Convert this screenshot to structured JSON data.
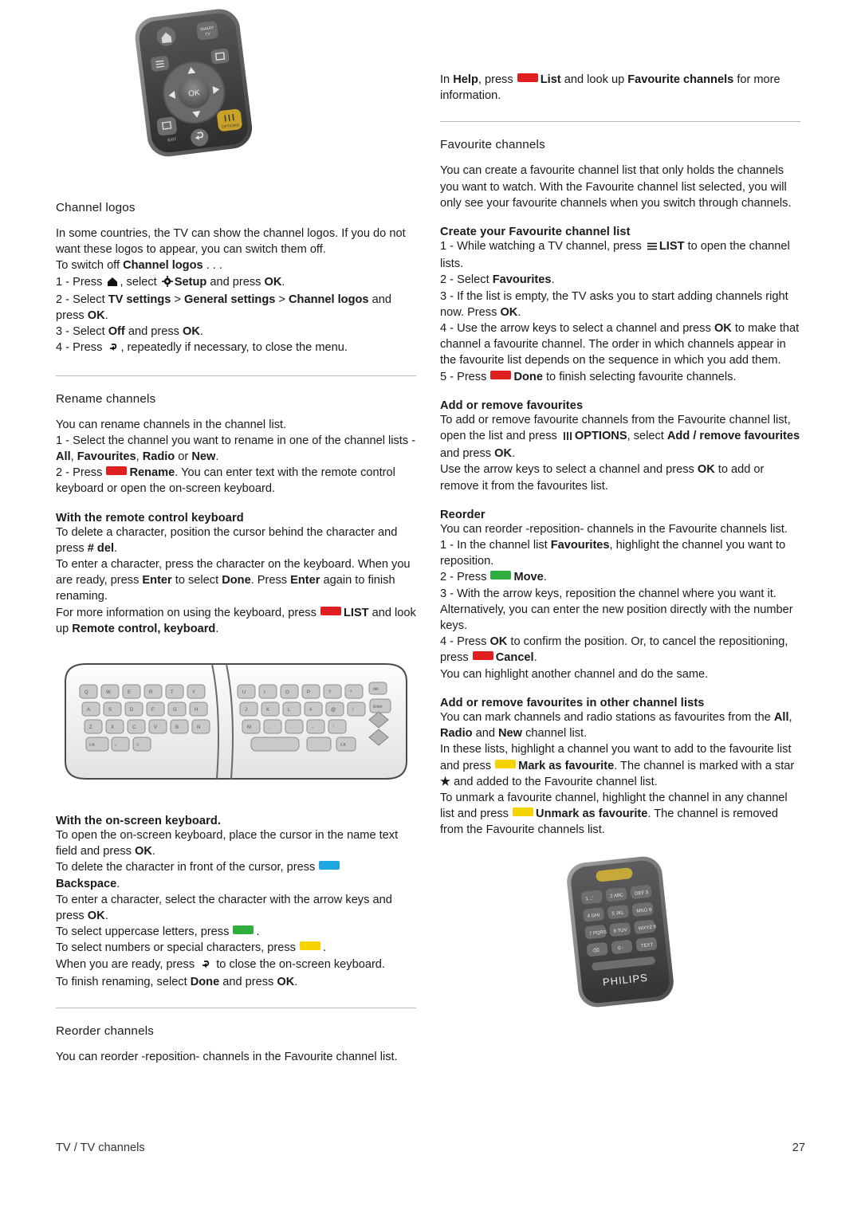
{
  "footer": {
    "breadcrumb": "TV / TV channels",
    "page_number": "27"
  },
  "left_column": {
    "channel_logos": {
      "heading": "Channel logos",
      "p1": "In some countries, the TV can show the channel logos. If you do not want these logos to appear, you can switch them off.",
      "p2_pre": "To switch off ",
      "p2_bold": "Channel logos",
      "p2_post": " . . .",
      "step1_pre": "1 - Press ",
      "step1_mid": ", select ",
      "step1_bold1": "Setup",
      "step1_mid2": " and press ",
      "step1_bold2": "OK",
      "step1_end": ".",
      "step2_pre": "2 - Select ",
      "step2_b1": "TV settings",
      "step2_sep1": " > ",
      "step2_b2": "General settings",
      "step2_sep2": " > ",
      "step2_b3": "Channel logos",
      "step2_mid": " and press ",
      "step2_b4": "OK",
      "step2_end": ".",
      "step3_pre": "3 - Select ",
      "step3_b1": "Off",
      "step3_mid": " and press ",
      "step3_b2": "OK",
      "step3_end": ".",
      "step4_pre": "4 - Press ",
      "step4_post": ", repeatedly if necessary, to close the menu."
    },
    "rename_channels": {
      "heading": "Rename channels",
      "p1": "You can rename channels in the channel list.",
      "step1_pre": "1 - Select the channel you want to rename in one of the channel lists - ",
      "step1_b1": "All",
      "step1_s1": ", ",
      "step1_b2": "Favourites",
      "step1_s2": ", ",
      "step1_b3": "Radio",
      "step1_s3": " or ",
      "step1_b4": "New",
      "step1_end": ".",
      "step2_pre": "2 - Press ",
      "step2_b1": "Rename",
      "step2_post": ". You can enter text with the remote control keyboard or open the on-screen keyboard."
    },
    "remote_keyboard": {
      "heading": "With the remote control keyboard",
      "p1_pre": "To delete a character, position the cursor behind the character and press ",
      "p1_b1": "# del",
      "p1_end": ".",
      "p2_pre": "To enter a character, press the character on the keyboard. When you are ready, press ",
      "p2_b1": "Enter",
      "p2_mid": " to select ",
      "p2_b2": "Done",
      "p2_mid2": ". Press ",
      "p2_b3": "Enter",
      "p2_end": " again to finish renaming.",
      "p3_pre": "For more information on using the keyboard, press ",
      "p3_b1": "LIST",
      "p3_mid": " and look up ",
      "p3_b2": "Remote control, keyboard",
      "p3_end": "."
    },
    "onscreen_keyboard": {
      "heading": "With the on-screen keyboard.",
      "p1_pre": "To open the on-screen keyboard, place the cursor in the name text field and press ",
      "p1_b1": "OK",
      "p1_end": ".",
      "p2_pre": "To delete the character in front of the cursor, press ",
      "p2_b1": "Backspace",
      "p2_end": ".",
      "p3_pre": "To enter a character, select the character with the arrow keys and press ",
      "p3_b1": "OK",
      "p3_end": ".",
      "p4": "To select uppercase letters, press ",
      "p4_end": ".",
      "p5": "To select numbers or special characters, press ",
      "p5_end": ".",
      "p6_pre": "When you are ready, press ",
      "p6_post": " to close the on-screen keyboard.",
      "p7_pre": "To finish renaming, select ",
      "p7_b1": "Done",
      "p7_mid": " and press ",
      "p7_b2": "OK",
      "p7_end": "."
    },
    "reorder_channels": {
      "heading": "Reorder channels",
      "p1": "You can reorder -reposition- channels in the Favourite channel list."
    }
  },
  "right_column": {
    "intro": {
      "pre": "In ",
      "b1": "Help",
      "mid": ", press ",
      "b2": "List",
      "mid2": " and look up ",
      "b3": "Favourite channels",
      "end": " for more information."
    },
    "favourite_channels": {
      "heading": "Favourite channels",
      "p1": "You can create a favourite channel list that only holds the channels you want to watch. With the Favourite channel list selected, you will only see your favourite channels when you switch through channels."
    },
    "create_list": {
      "heading": "Create your Favourite channel list",
      "step1_pre": "1 - While watching a TV channel, press ",
      "step1_b1": "LIST",
      "step1_post": " to open the channel lists.",
      "step2_pre": "2 - Select ",
      "step2_b1": "Favourites",
      "step2_end": ".",
      "step3_pre": "3 - If the list is empty, the TV asks you to start adding channels right now. Press ",
      "step3_b1": "OK",
      "step3_end": ".",
      "step4_pre": "4 - Use the arrow keys to select a channel and press ",
      "step4_b1": "OK",
      "step4_post": " to make that channel a favourite channel. The order in which channels appear in the favourite list depends on the sequence in which you add them.",
      "step5_pre": "5 - Press ",
      "step5_b1": "Done",
      "step5_post": " to finish selecting favourite channels."
    },
    "add_remove": {
      "heading": "Add or remove favourites",
      "p1_pre": "To add or remove favourite channels from the Favourite channel list, open the list and press ",
      "p1_b1": "OPTIONS",
      "p1_mid": ", select ",
      "p1_b2": "Add / remove favourites",
      "p1_mid2": " and press ",
      "p1_b3": "OK",
      "p1_end": ".",
      "p2_pre": "Use the arrow keys to select a channel and press ",
      "p2_b1": "OK",
      "p2_post": " to add or remove it from the favourites list."
    },
    "reorder": {
      "heading": "Reorder",
      "p1": "You can reorder -reposition- channels in the Favourite channels list.",
      "step1_pre": "1 - In the channel list ",
      "step1_b1": "Favourites",
      "step1_post": ", highlight the channel you want to reposition.",
      "step2_pre": "2 - Press ",
      "step2_b1": "Move",
      "step2_end": ".",
      "step3": "3 - With the arrow keys, reposition the channel where you want it. Alternatively, you can enter the new position directly with the number keys.",
      "step4_pre": "4 - Press ",
      "step4_b1": "OK",
      "step4_mid": " to confirm the position. Or, to cancel the repositioning, press ",
      "step4_b2": "Cancel",
      "step4_end": ".",
      "p_end": "You can highlight another channel and do the same."
    },
    "add_remove_other": {
      "heading": "Add or remove favourites in other channel lists",
      "p1_pre": "You can mark channels and radio stations as favourites from the ",
      "p1_b1": "All",
      "p1_s1": ", ",
      "p1_b2": "Radio",
      "p1_s2": " and ",
      "p1_b3": "New",
      "p1_end": " channel list.",
      "p2_pre": "In these lists, highlight a channel you want to add to the favourite list and press ",
      "p2_b1": "Mark as favourite",
      "p2_mid": ". The channel is marked with a star ",
      "p2_star": "★",
      "p2_post": " and added to the Favourite channel list.",
      "p3_pre": "To unmark a favourite channel, highlight the channel in any channel list and press ",
      "p3_b1": "Unmark as favourite",
      "p3_post": ". The channel is removed from the Favourite channels list."
    },
    "brand": "PHILIPS"
  },
  "images": {
    "remote_top_label": "philips-remote-control-top",
    "keyboard_label": "remote-control-qwerty-keyboard",
    "remote_bottom_label": "philips-remote-control-numeric-keypad"
  }
}
